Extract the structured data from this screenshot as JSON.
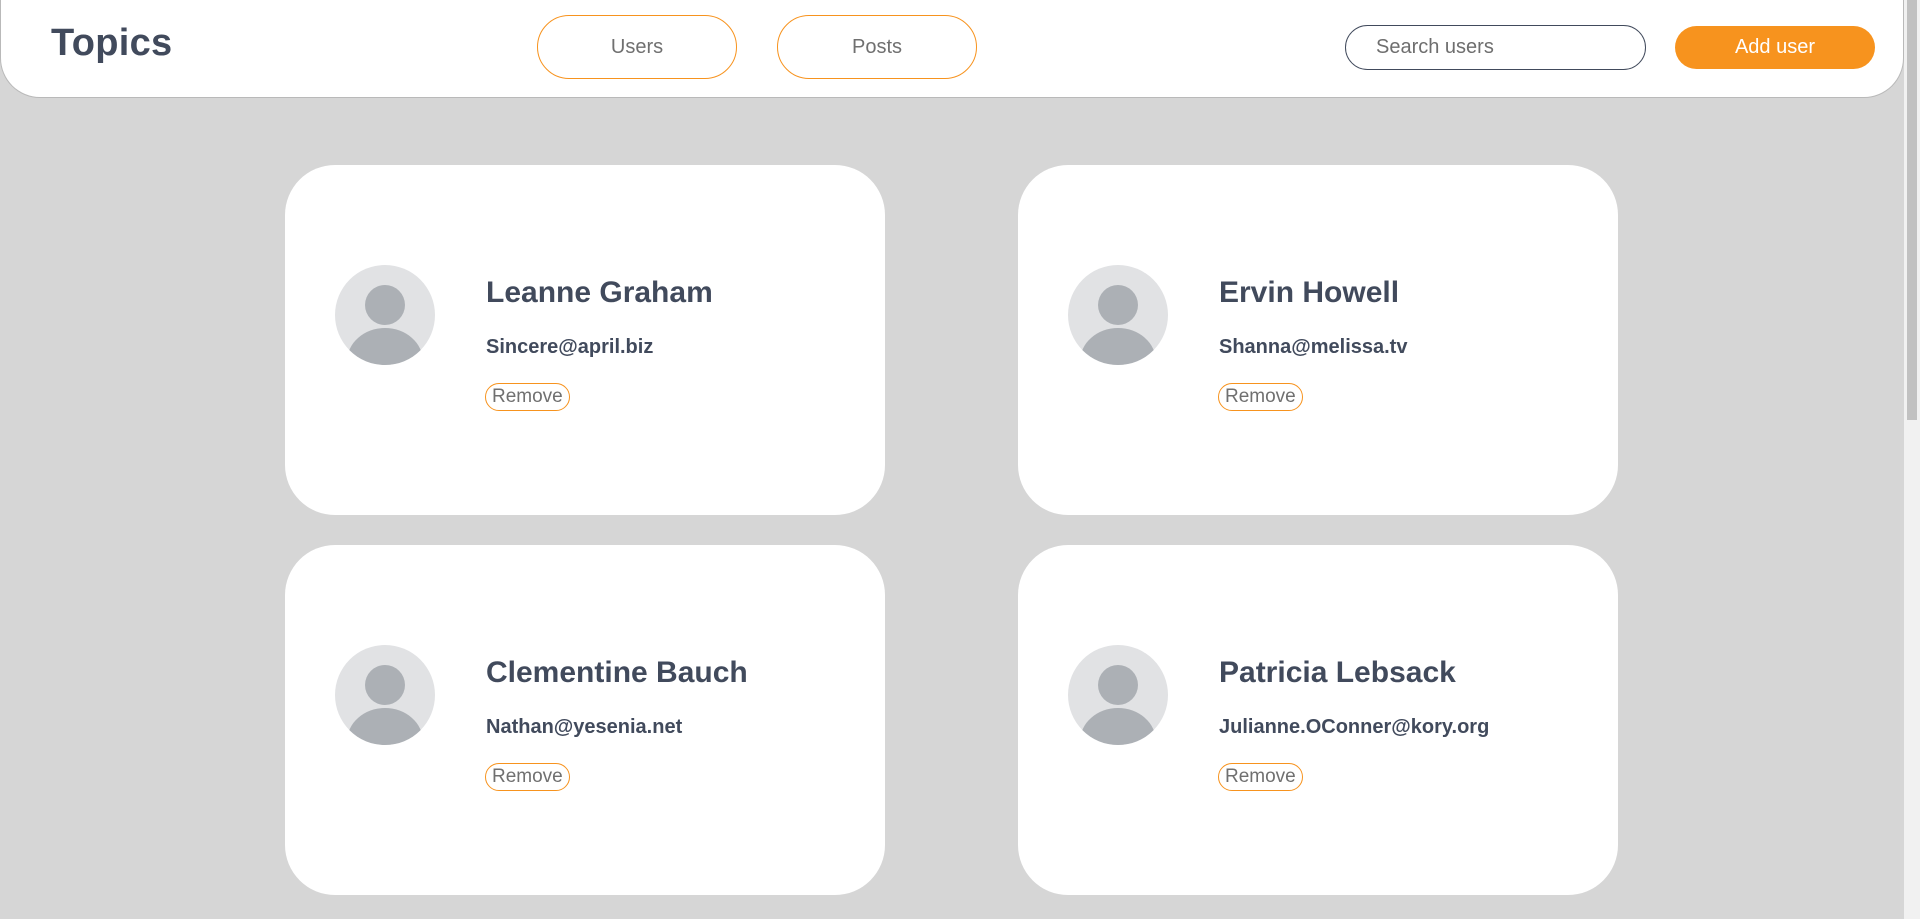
{
  "header": {
    "logo": "Topics",
    "nav": {
      "users_label": "Users",
      "posts_label": "Posts"
    },
    "search": {
      "placeholder": "Search users",
      "value": ""
    },
    "add_user_label": "Add user"
  },
  "users": [
    {
      "name": "Leanne Graham",
      "email": "Sincere@april.biz",
      "remove_label": "Remove"
    },
    {
      "name": "Ervin Howell",
      "email": "Shanna@melissa.tv",
      "remove_label": "Remove"
    },
    {
      "name": "Clementine Bauch",
      "email": "Nathan@yesenia.net",
      "remove_label": "Remove"
    },
    {
      "name": "Patricia Lebsack",
      "email": "Julianne.OConner@kory.org",
      "remove_label": "Remove"
    }
  ],
  "colors": {
    "accent": "#f7931e",
    "text_dark": "#414a5c",
    "background": "#d6d6d6",
    "card": "#ffffff"
  },
  "icons": {
    "avatar": "user-avatar-icon"
  }
}
